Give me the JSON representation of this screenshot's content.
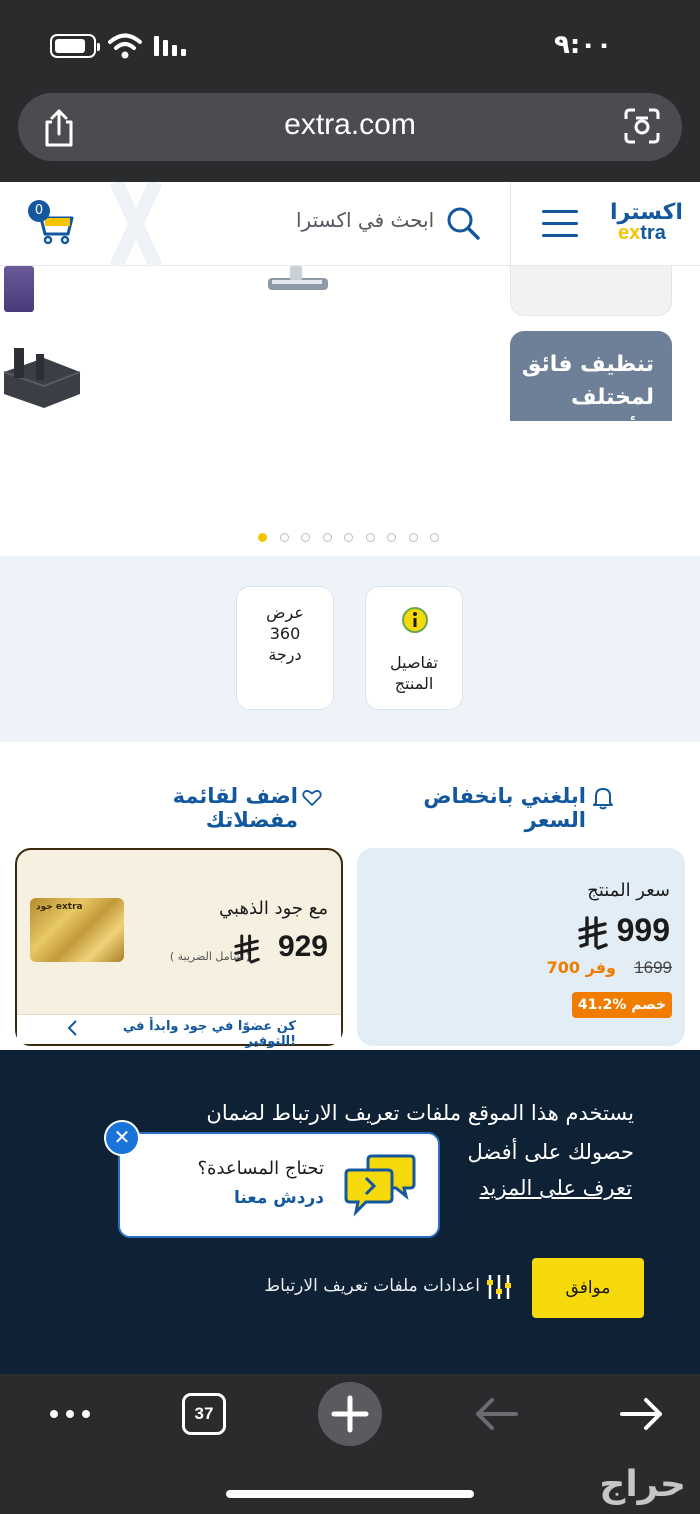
{
  "status_bar": {
    "time": "٩:٠٠"
  },
  "browser": {
    "url": "extra.com",
    "tab_count": "37"
  },
  "header": {
    "logo_ar": "اكسترا",
    "logo_en_prefix": "ex",
    "logo_en_suffix": "tra",
    "search_placeholder": "ابحث في اكسترا",
    "cart_count": "0"
  },
  "hero": {
    "promo_text": "تنظيف فائق لمختلف الأسطح",
    "slide_count": 9,
    "active_slide": 0
  },
  "features": [
    {
      "label": "عرض 360 درجة",
      "lines": [
        "عرض",
        "360",
        "درجة"
      ]
    },
    {
      "label": "تفاصيل المنتج",
      "lines": [
        "تفاصيل",
        "المنتج"
      ]
    }
  ],
  "actions": {
    "notify_price_drop": "ابلغني بانخفاض السعر",
    "add_wishlist": "اضف لقائمة مفضلاتك"
  },
  "price": {
    "label": "سعر المنتج",
    "current": "999",
    "old": "1699",
    "save": "وفر 700",
    "discount": "41.2% خصم"
  },
  "gold": {
    "title": "مع جود الذهبي",
    "price": "929",
    "tax_note": "( شامل الضريبة )",
    "cta": "كن عضوًا في جود وابدأ في التوفير!",
    "card_logo": "جود extra"
  },
  "cookie": {
    "text": "يستخدم هذا الموقع ملفات تعريف الارتباط لضمان حصولك على أفضل",
    "learn_more": "تعرف على المزيد",
    "accept": "موافق",
    "settings": "اعدادات ملفات تعريف الارتباط"
  },
  "chat": {
    "title": "تحتاج المساعدة؟",
    "link": "دردش معنا"
  },
  "watermark": "حراج",
  "colors": {
    "brand_blue": "#13589e",
    "brand_yellow": "#f5c400",
    "discount_orange": "#f07d00",
    "cookie_bg": "#0f2235"
  }
}
